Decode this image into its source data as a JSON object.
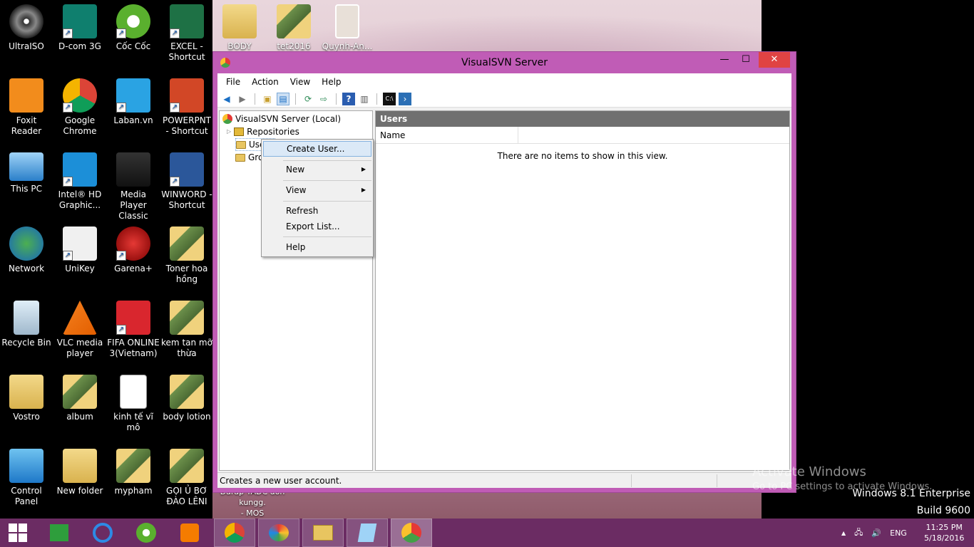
{
  "desktop": {
    "icons": [
      {
        "label": "UltraISO"
      },
      {
        "label": "D-com 3G"
      },
      {
        "label": "Cốc Cốc"
      },
      {
        "label": "EXCEL - Shortcut"
      },
      {
        "label": "Foxit Reader"
      },
      {
        "label": "Google Chrome"
      },
      {
        "label": "Laban.vn"
      },
      {
        "label": "POWERPNT - Shortcut"
      },
      {
        "label": "This PC"
      },
      {
        "label": "Intel® HD Graphic..."
      },
      {
        "label": "Media Player Classic"
      },
      {
        "label": "WINWORD - Shortcut"
      },
      {
        "label": "Network"
      },
      {
        "label": "UniKey"
      },
      {
        "label": "Garena+"
      },
      {
        "label": "Toner hoa hồng"
      },
      {
        "label": "Recycle Bin"
      },
      {
        "label": "VLC media player"
      },
      {
        "label": "FIFA ONLINE 3(Vietnam)"
      },
      {
        "label": "kem tan mỡ thừa"
      },
      {
        "label": "Vostro"
      },
      {
        "label": "album"
      },
      {
        "label": "kinh tế vĩ mô"
      },
      {
        "label": "body lotion"
      },
      {
        "label": "Control Panel"
      },
      {
        "label": "New folder"
      },
      {
        "label": "mypham"
      },
      {
        "label": "GỌI Ủ BƠ ĐÀO LÊNI"
      },
      {
        "label": "BODY"
      },
      {
        "label": "tet2016"
      },
      {
        "label": "Quynh-An..."
      }
    ],
    "partial_label": "- MOS",
    "partial_label2": "Đarap TADC  đơn kungg."
  },
  "window": {
    "title": "VisualSVN Server",
    "minimize": "—",
    "maximize": "☐",
    "close": "✕",
    "menu": [
      "File",
      "Action",
      "View",
      "Help"
    ],
    "tree": {
      "root": "VisualSVN Server (Local)",
      "repositories": "Repositories",
      "users": "Users",
      "groups": "Groups"
    },
    "pane_title": "Users",
    "column_name": "Name",
    "empty_text": "There are no items to show in this view.",
    "status": "Creates a new user account."
  },
  "context_menu": {
    "items": [
      "Create User...",
      "New",
      "View",
      "Refresh",
      "Export List...",
      "Help"
    ],
    "submenu_arrow": "▶"
  },
  "watermark": {
    "line1": "Activate Windows",
    "line2": "Go to PC settings to activate Windows.",
    "edition": "Windows 8.1 Enterprise",
    "build": "Build 9600"
  },
  "taskbar": {
    "lang": "ENG",
    "time": "11:25 PM",
    "date": "5/18/2016"
  }
}
